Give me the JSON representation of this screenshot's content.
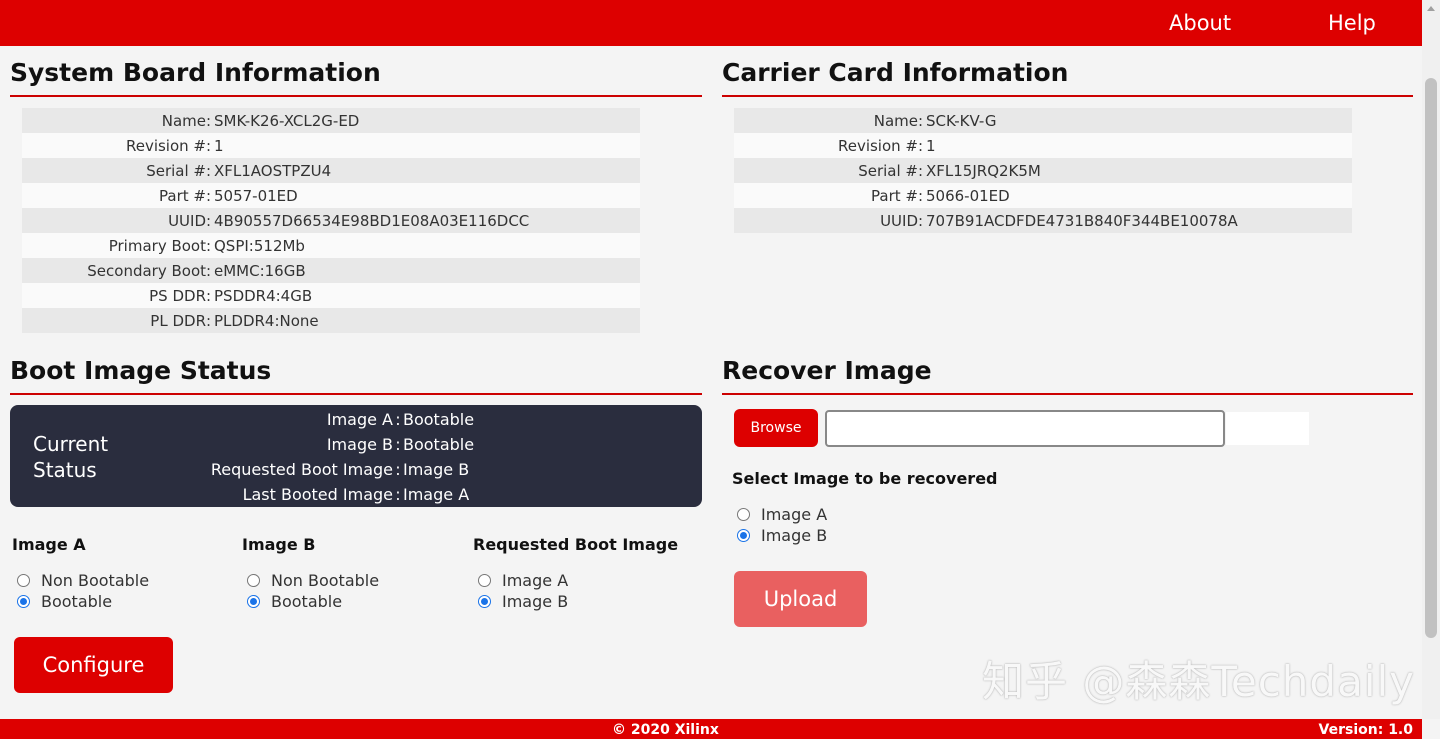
{
  "nav": {
    "about": "About",
    "help": "Help"
  },
  "system_board": {
    "title": "System Board Information",
    "rows": [
      {
        "label": "Name",
        "value": "SMK-K26-XCL2G-ED"
      },
      {
        "label": "Revision #",
        "value": "1"
      },
      {
        "label": "Serial #",
        "value": "XFL1AOSTPZU4"
      },
      {
        "label": "Part #",
        "value": "5057-01ED"
      },
      {
        "label": "UUID",
        "value": "4B90557D66534E98BD1E08A03E116DCC"
      },
      {
        "label": "Primary Boot",
        "value": "QSPI:512Mb"
      },
      {
        "label": "Secondary Boot",
        "value": "eMMC:16GB"
      },
      {
        "label": "PS DDR",
        "value": "PSDDR4:4GB"
      },
      {
        "label": "PL DDR",
        "value": "PLDDR4:None"
      }
    ]
  },
  "carrier_card": {
    "title": "Carrier Card Information",
    "rows": [
      {
        "label": "Name",
        "value": "SCK-KV-G"
      },
      {
        "label": "Revision #",
        "value": "1"
      },
      {
        "label": "Serial #",
        "value": "XFL15JRQ2K5M"
      },
      {
        "label": "Part #",
        "value": "5066-01ED"
      },
      {
        "label": "UUID",
        "value": "707B91ACDFDE4731B840F344BE10078A"
      }
    ]
  },
  "boot_status": {
    "title": "Boot Image Status",
    "current_status": "Current Status",
    "lines": [
      {
        "label": "Image A",
        "value": "Bootable"
      },
      {
        "label": "Image B",
        "value": "Bootable"
      },
      {
        "label": "Requested Boot Image",
        "value": "Image B"
      },
      {
        "label": "Last Booted Image",
        "value": "Image A"
      }
    ],
    "separator": ":"
  },
  "config": {
    "image_a": {
      "title": "Image A",
      "options": [
        "Non Bootable",
        "Bootable"
      ],
      "selected": "Bootable"
    },
    "image_b": {
      "title": "Image B",
      "options": [
        "Non Bootable",
        "Bootable"
      ],
      "selected": "Bootable"
    },
    "requested": {
      "title": "Requested Boot Image",
      "options": [
        "Image A",
        "Image B"
      ],
      "selected": "Image B"
    },
    "configure_label": "Configure"
  },
  "recover": {
    "title": "Recover Image",
    "browse_label": "Browse",
    "file_value": "",
    "select_label": "Select Image to be recovered",
    "options": [
      "Image A",
      "Image B"
    ],
    "selected": "Image B",
    "upload_label": "Upload"
  },
  "watermark": "知乎 @森森Techdaily",
  "footer": {
    "copyright": "© 2020 Xilinx",
    "version": "Version: 1.0"
  },
  "colors": {
    "brand_red": "#dd0000",
    "status_bg": "#2a2d3e",
    "upload_disabled": "#e96060",
    "radio_blue": "#1a73e8"
  }
}
